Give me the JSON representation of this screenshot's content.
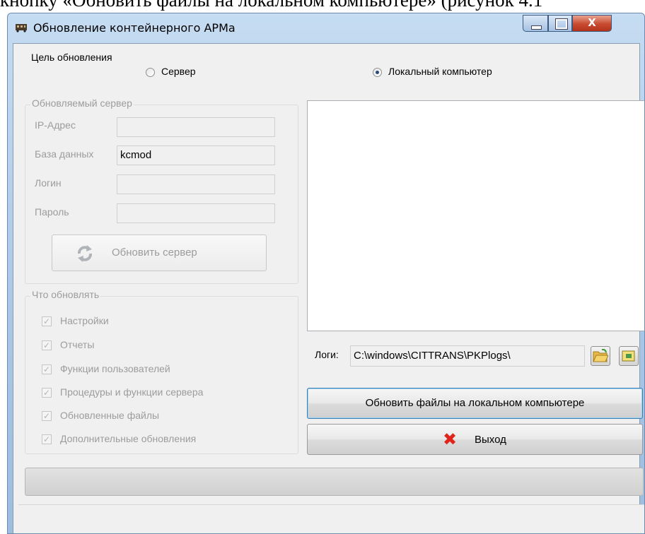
{
  "caption_text": "кнопку «Обновить файлы на локальном компьютере» (рисунок 4.1",
  "window": {
    "title": "Обновление контейнерного АРМа",
    "close_glyph": "X"
  },
  "target": {
    "label": "Цель обновления",
    "options": [
      {
        "label": "Сервер",
        "selected": false
      },
      {
        "label": "Локальный компьютер",
        "selected": true
      }
    ]
  },
  "server_group": {
    "title": "Обновляемый сервер",
    "fields": [
      {
        "label": "IP-Адрес",
        "value": ""
      },
      {
        "label": "База данных",
        "value": "kcmod"
      },
      {
        "label": "Логин",
        "value": ""
      },
      {
        "label": "Пароль",
        "value": ""
      }
    ],
    "update_button": "Обновить сервер"
  },
  "what_group": {
    "title": "Что обновлять",
    "items": [
      {
        "label": "Настройки",
        "checked": true
      },
      {
        "label": "Отчеты",
        "checked": true
      },
      {
        "label": "Функции пользователей",
        "checked": true
      },
      {
        "label": "Процедуры и функции сервера",
        "checked": true
      },
      {
        "label": "Обновленные файлы",
        "checked": true
      },
      {
        "label": "Дополнительные обновления",
        "checked": true
      }
    ]
  },
  "logs": {
    "label": "Логи:",
    "path": "C:\\windows\\CITTRANS\\PKPlogs\\"
  },
  "buttons": {
    "update_local": "Обновить файлы на локальном компьютере",
    "exit": "Выход",
    "exit_glyph": "✖"
  },
  "colors": {
    "accent_blue": "#3c7fb1",
    "exit_red": "#e0241b"
  },
  "icons": [
    "app-icon",
    "refresh-icon",
    "folder-open-icon",
    "log-view-icon",
    "exit-x-icon"
  ]
}
